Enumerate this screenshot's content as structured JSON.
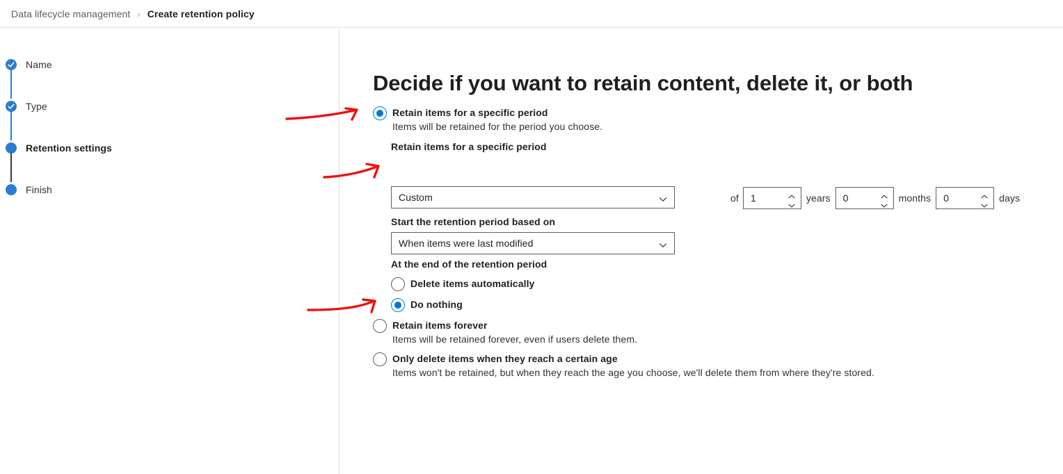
{
  "header": {
    "breadcrumb": {
      "root": "Data lifecycle management",
      "separator": "›",
      "current": "Create retention policy"
    }
  },
  "wizard": {
    "steps": [
      {
        "label": "Name",
        "state": "completed"
      },
      {
        "label": "Type",
        "state": "completed"
      },
      {
        "label": "Retention settings",
        "state": "current"
      },
      {
        "label": "Finish",
        "state": "upcoming"
      }
    ]
  },
  "main": {
    "title": "Decide if you want to retain content, delete it, or both",
    "options": [
      {
        "id": "retain-specific-period",
        "title": "Retain items for a specific period",
        "description": "Items will be retained for the period you choose.",
        "selected": true
      },
      {
        "id": "retain-forever",
        "title": "Retain items forever",
        "description": "Items will be retained forever, even if users delete them.",
        "selected": false
      },
      {
        "id": "only-delete-certain-age",
        "title": "Only delete items when they reach a certain age",
        "description": "Items won't be retained, but when they reach the age you choose, we'll delete them from where they're stored.",
        "selected": false
      }
    ],
    "period_section": {
      "label": "Retain items for a specific period",
      "prefix_word": "of",
      "years": {
        "value": "1",
        "unit": "years"
      },
      "months": {
        "value": "0",
        "unit": "months"
      },
      "days": {
        "value": "0",
        "unit": "days"
      },
      "preset_dropdown": {
        "value": "Custom"
      },
      "start_label": "Start the retention period based on",
      "start_dropdown": {
        "value": "When items were last modified"
      },
      "end_label": "At the end of the retention period",
      "end_options": [
        {
          "id": "delete-automatically",
          "label": "Delete items automatically",
          "selected": false
        },
        {
          "id": "do-nothing",
          "label": "Do nothing",
          "selected": true
        }
      ]
    }
  },
  "colors": {
    "accent": "#0078d4",
    "step_blue": "#2b7cd3",
    "annotation_red": "#ee1111",
    "border": "#605e5c",
    "divider": "#e1dfdd"
  },
  "annotations": [
    {
      "name": "arrow-to-retain-period-radio"
    },
    {
      "name": "arrow-to-years-spinner"
    },
    {
      "name": "arrow-to-do-nothing-radio"
    }
  ]
}
